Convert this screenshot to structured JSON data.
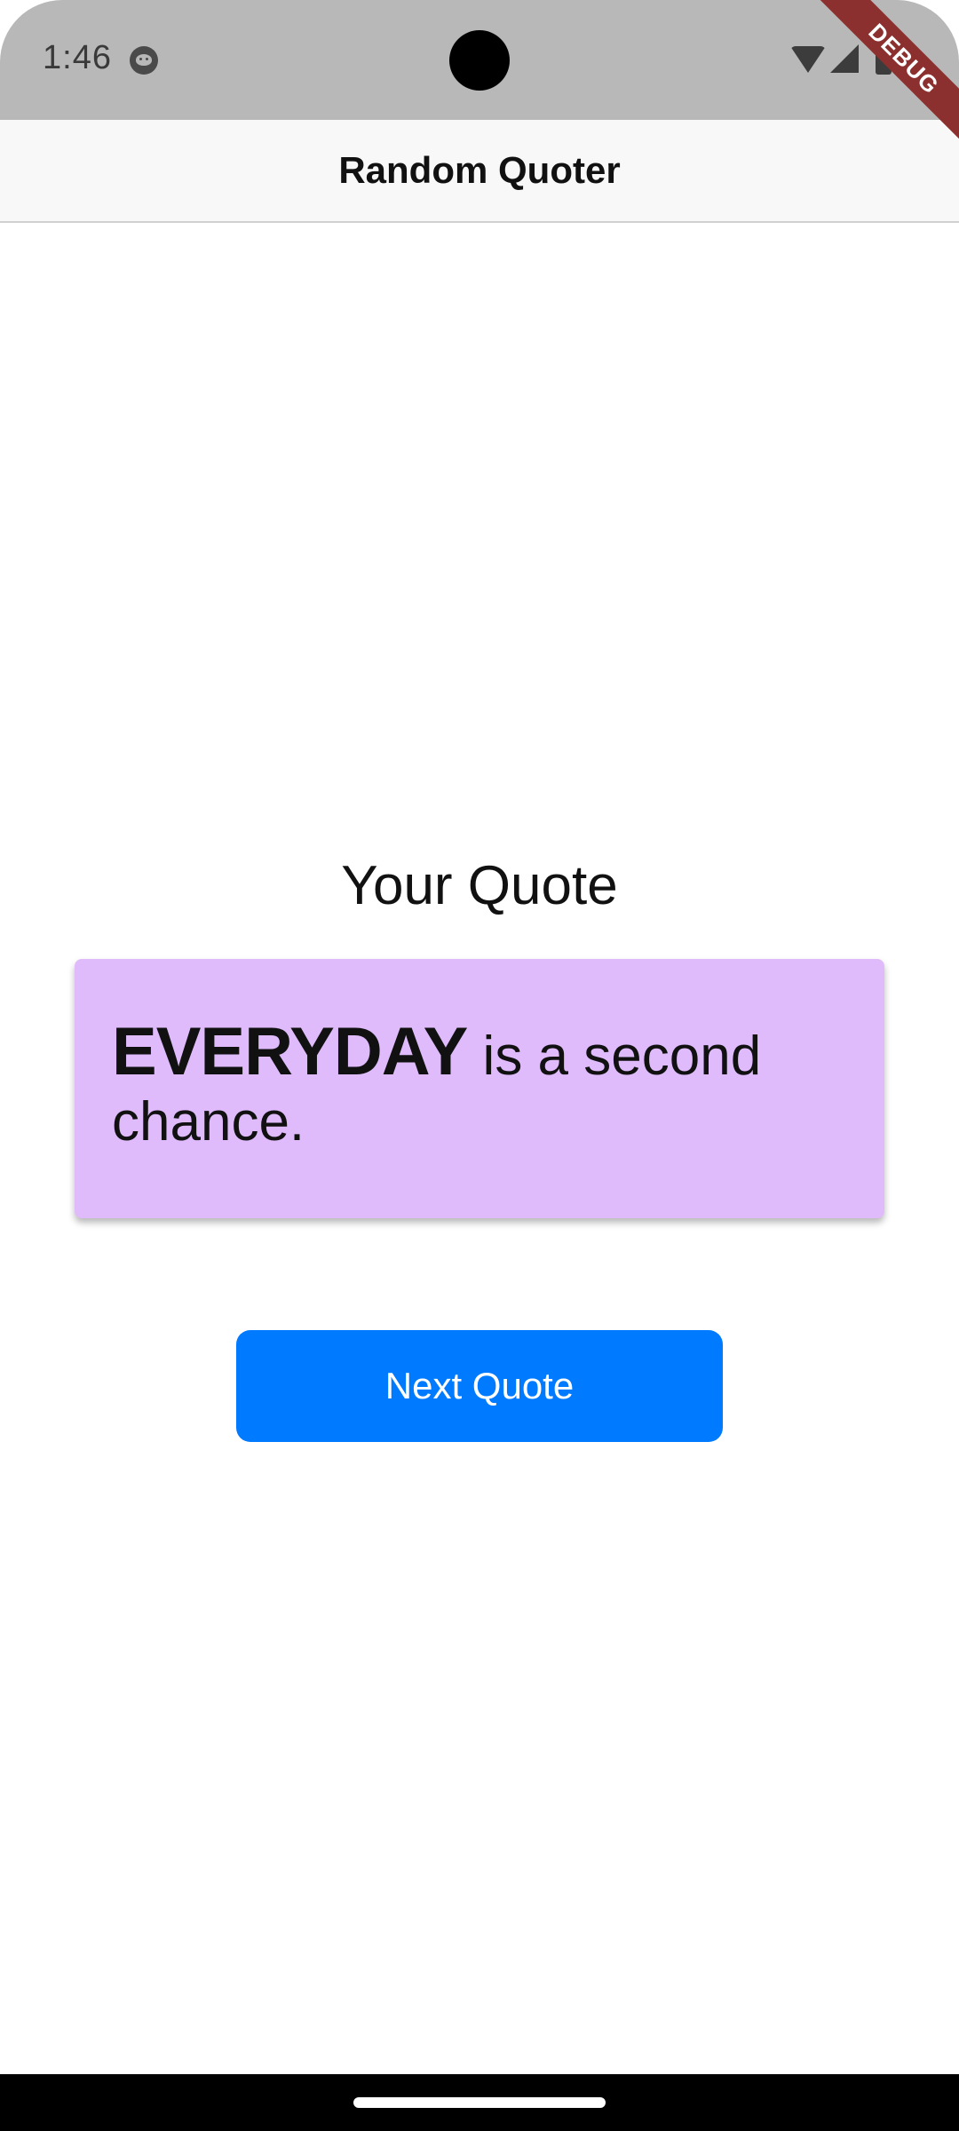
{
  "status_bar": {
    "time": "1:46",
    "notification_icon": "app-notification-icon",
    "icons": [
      "wifi-icon",
      "signal-icon",
      "battery-icon"
    ]
  },
  "debug_banner": "DEBUG",
  "app_bar": {
    "title": "Random Quoter"
  },
  "main": {
    "heading": "Your Quote",
    "quote": {
      "emphasis": "EVERYDAY",
      "rest": " is a second chance."
    },
    "next_button_label": "Next Quote"
  },
  "colors": {
    "card_background": "#dfbbfc",
    "button_background": "#007aff",
    "status_bar_background": "#b8b8b8",
    "debug_banner": "#8b2f2f"
  }
}
